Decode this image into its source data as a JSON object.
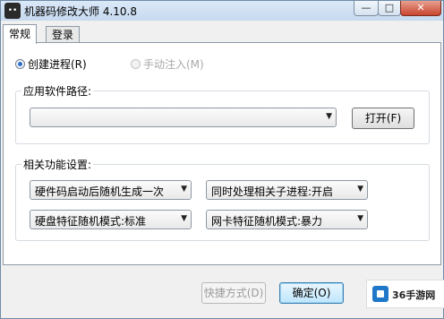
{
  "window": {
    "title": "机器码修改大师 4.10.8",
    "icon_text": "••",
    "min_glyph": "—",
    "max_glyph": "□",
    "close_glyph": "✕"
  },
  "tabs": [
    {
      "label": "常规",
      "active": true
    },
    {
      "label": "登录",
      "active": false
    }
  ],
  "mode": {
    "create_process": {
      "label": "创建进程(R)",
      "checked": true
    },
    "manual_inject": {
      "label": "手动注入(M)",
      "checked": false,
      "disabled": true
    }
  },
  "app_path": {
    "group_title": "应用软件路径:",
    "value": "",
    "open_button": "打开(F)"
  },
  "features": {
    "group_title": "相关功能设置:",
    "dropdowns": [
      {
        "value": "硬件码启动后随机生成一次"
      },
      {
        "value": "同时处理相关子进程:开启"
      },
      {
        "value": "硬盘特征随机模式:标准"
      },
      {
        "value": "网卡特征随机模式:暴力"
      }
    ]
  },
  "footer": {
    "shortcut_button": "快捷方式(D)",
    "ok_button": "确定(O)"
  },
  "watermark": {
    "text": "36手游网"
  },
  "colors": {
    "accent": "#2f6ec8",
    "title_bar": "#c6d9ef",
    "close": "#c8452e"
  },
  "icons": {
    "dropdown": "chevron-down-icon"
  }
}
